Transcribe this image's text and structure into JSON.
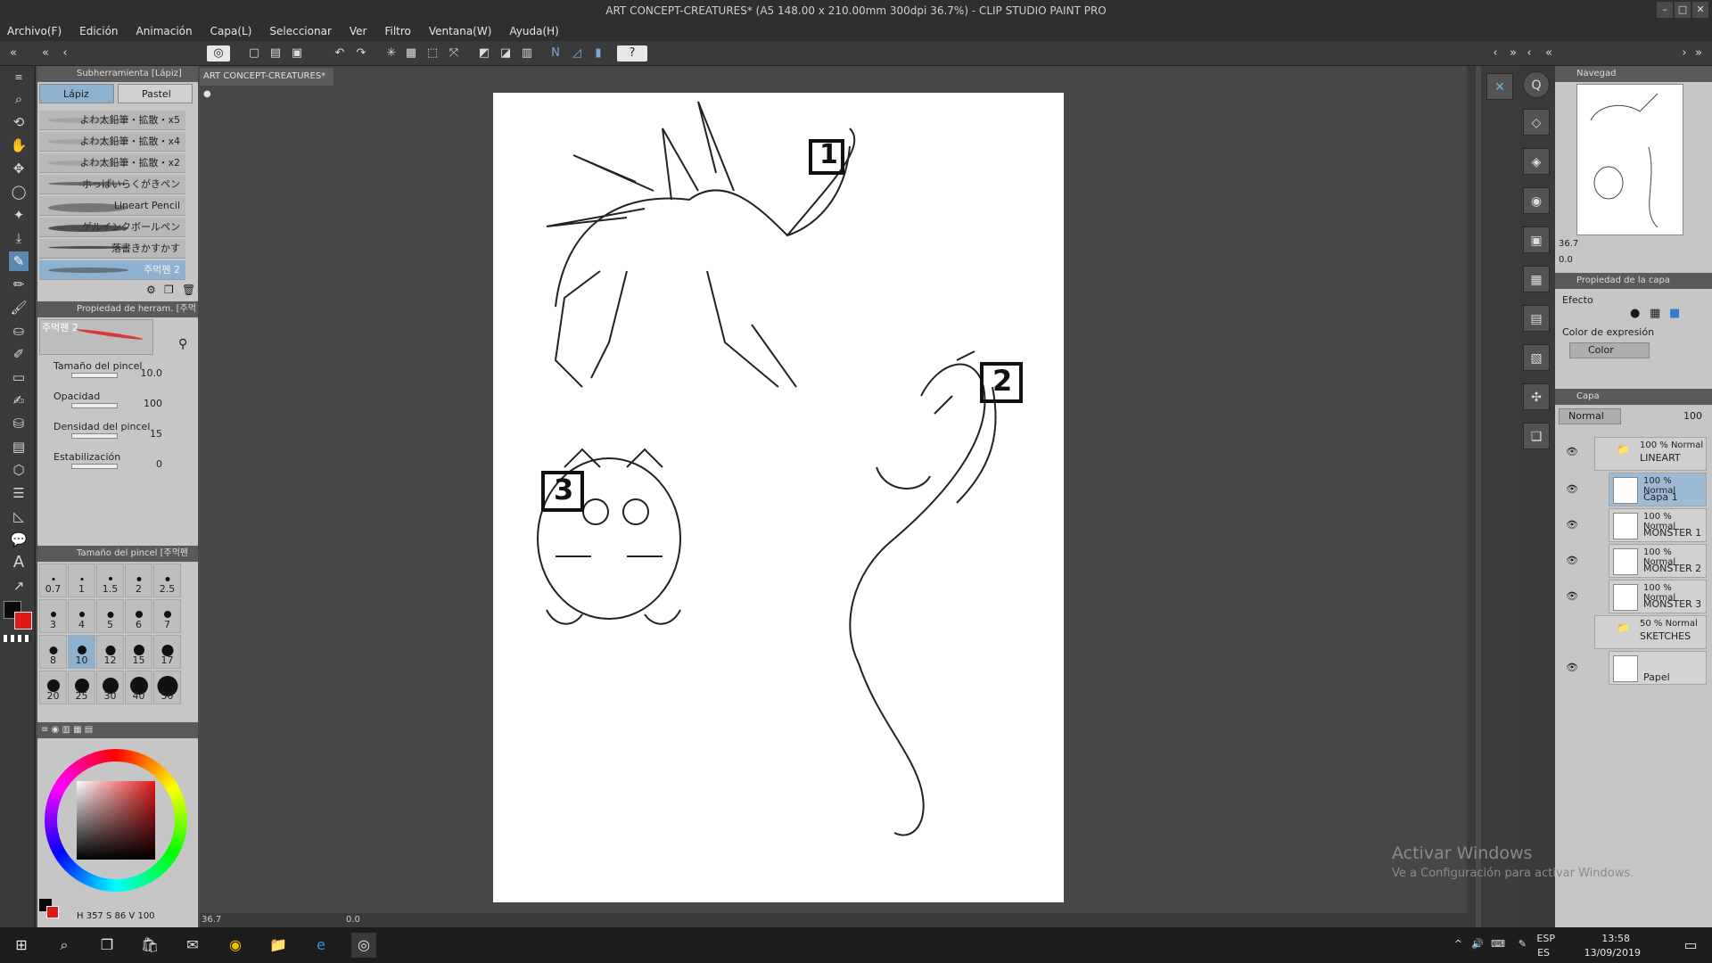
{
  "window": {
    "title": "ART CONCEPT-CREATURES* (A5 148.00 x 210.00mm 300dpi 36.7%) - CLIP STUDIO PAINT PRO",
    "controls": [
      "–",
      "□",
      "✕"
    ]
  },
  "menu": [
    "Archivo(F)",
    "Edición",
    "Animación",
    "Capa(L)",
    "Seleccionar",
    "Ver",
    "Filtro",
    "Ventana(W)",
    "Ayuda(H)"
  ],
  "subtool_panel": {
    "header": "Subherramienta [Lápiz]",
    "tabs": [
      "Lápiz",
      "Pastel"
    ],
    "brushes": [
      "よわ太鉛筆・拡散・x5",
      "よわ太鉛筆・拡散・x4",
      "よわ太鉛筆・拡散・x2",
      "ホっぱいらくがきペン",
      "Lineart Pencil",
      "ゲルインクボールペン",
      "落書きかすかす",
      "주먹펜 2"
    ],
    "selected_index": 7
  },
  "tool_property": {
    "header": "Propiedad de herram. [주먹펜",
    "preview_label": "주먹펜 2",
    "props": [
      {
        "label": "Tamaño del pincel",
        "value": "10.0"
      },
      {
        "label": "Opacidad",
        "value": "100"
      },
      {
        "label": "Densidad del pincel",
        "value": "15"
      },
      {
        "label": "Estabilización",
        "value": "0"
      }
    ]
  },
  "brush_size": {
    "header": "Tamaño del pincel [주먹펜 2]",
    "sizes": [
      "0.7",
      "1",
      "1.5",
      "2",
      "2.5",
      "3",
      "4",
      "5",
      "6",
      "7",
      "8",
      "10",
      "12",
      "15",
      "17",
      "20",
      "25",
      "30",
      "40",
      "50"
    ],
    "selected": "10"
  },
  "color": {
    "readout_h": "357",
    "readout_s": "86",
    "readout_v": "100",
    "main_color": "#0a0a0a",
    "sub_color": "#e01818"
  },
  "document": {
    "tab": "ART CONCEPT-CREATURES*",
    "zoom": "36.7",
    "rotation": "0.0",
    "labels": [
      "1",
      "2",
      "3"
    ]
  },
  "navigator": {
    "header": "Navegad",
    "zoom": "36.7",
    "angle": "0.0"
  },
  "layer_property": {
    "header": "Propiedad de la capa",
    "effect_label": "Efecto",
    "expression_label": "Color de expresión",
    "expression_value": "Color"
  },
  "layers": {
    "header": "Capa",
    "blend_mode": "Normal",
    "opacity": "100",
    "items": [
      {
        "line1": "100 % Normal",
        "line2": "LINEART",
        "folder": true
      },
      {
        "line1": "100 % Normal",
        "line2": "Capa 1",
        "selected": true
      },
      {
        "line1": "100 % Normal",
        "line2": "MONSTER 1"
      },
      {
        "line1": "100 % Normal",
        "line2": "MONSTER 2"
      },
      {
        "line1": "100 % Normal",
        "line2": "MONSTER 3"
      },
      {
        "line1": "50 % Normal",
        "line2": "SKETCHES",
        "folder": true
      },
      {
        "line1": "",
        "line2": "Papel"
      }
    ]
  },
  "watermark": {
    "line1": "Activar Windows",
    "line2": "Ve a Configuración para activar Windows."
  },
  "taskbar": {
    "lang": "ESP",
    "lang2": "ES",
    "time": "13:58",
    "date": "13/09/2019"
  }
}
